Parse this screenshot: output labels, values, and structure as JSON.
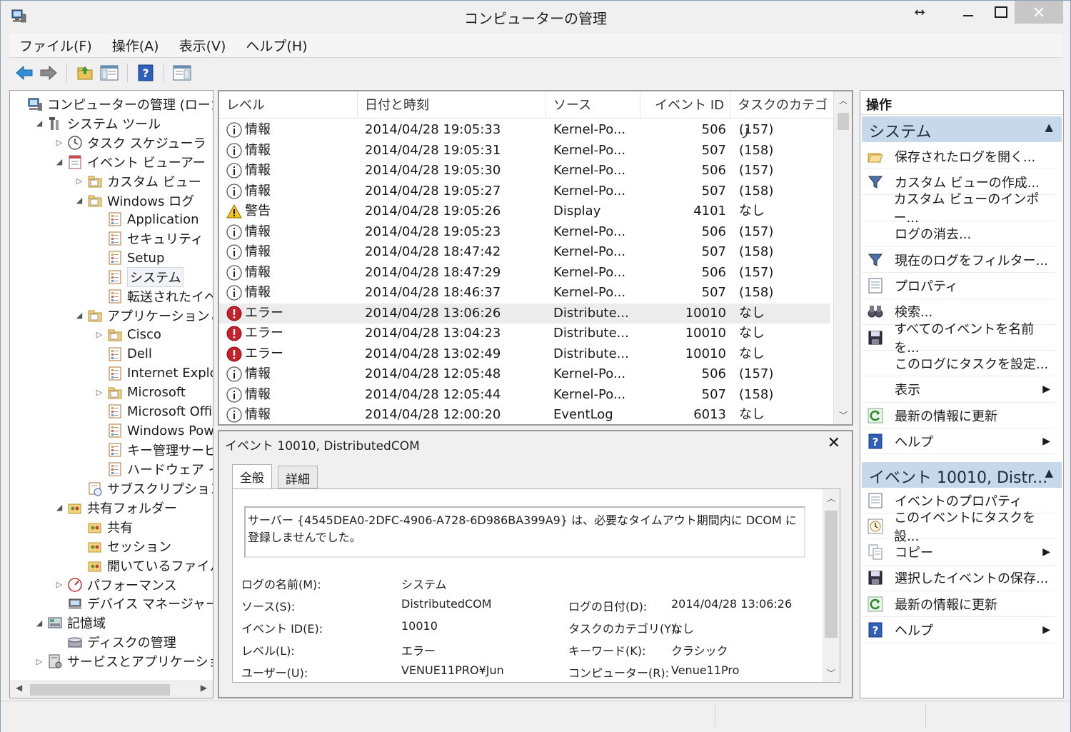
{
  "window": {
    "title": "コンピューターの管理"
  },
  "menu": [
    "ファイル(F)",
    "操作(A)",
    "表示(V)",
    "ヘルプ(H)"
  ],
  "tree": [
    {
      "label": "コンピューターの管理 (ローカル)",
      "depth": 0,
      "exp": "",
      "icon": "computer-mgmt-icon"
    },
    {
      "label": "システム ツール",
      "depth": 1,
      "exp": "◢",
      "icon": "system-tools-icon"
    },
    {
      "label": "タスク スケジューラ",
      "depth": 2,
      "exp": "▷",
      "icon": "clock-icon"
    },
    {
      "label": "イベント ビューアー",
      "depth": 2,
      "exp": "◢",
      "icon": "event-viewer-icon"
    },
    {
      "label": "カスタム ビュー",
      "depth": 3,
      "exp": "▷",
      "icon": "folder-icon"
    },
    {
      "label": "Windows ログ",
      "depth": 3,
      "exp": "◢",
      "icon": "folder-icon"
    },
    {
      "label": "Application",
      "depth": 4,
      "exp": "",
      "icon": "log-icon"
    },
    {
      "label": "セキュリティ",
      "depth": 4,
      "exp": "",
      "icon": "log-icon"
    },
    {
      "label": "Setup",
      "depth": 4,
      "exp": "",
      "icon": "log-icon"
    },
    {
      "label": "システム",
      "depth": 4,
      "exp": "",
      "icon": "log-icon",
      "selected": true
    },
    {
      "label": "転送されたイベント",
      "depth": 4,
      "exp": "",
      "icon": "log-icon"
    },
    {
      "label": "アプリケーションとサービ",
      "depth": 3,
      "exp": "◢",
      "icon": "folder-icon"
    },
    {
      "label": "Cisco",
      "depth": 4,
      "exp": "▷",
      "icon": "folder-icon"
    },
    {
      "label": "Dell",
      "depth": 4,
      "exp": "",
      "icon": "log-icon"
    },
    {
      "label": "Internet Explor",
      "depth": 4,
      "exp": "",
      "icon": "log-icon"
    },
    {
      "label": "Microsoft",
      "depth": 4,
      "exp": "▷",
      "icon": "folder-icon"
    },
    {
      "label": "Microsoft Office",
      "depth": 4,
      "exp": "",
      "icon": "log-icon"
    },
    {
      "label": "Windows Powe",
      "depth": 4,
      "exp": "",
      "icon": "log-icon"
    },
    {
      "label": "キー管理サービス",
      "depth": 4,
      "exp": "",
      "icon": "log-icon"
    },
    {
      "label": "ハードウェア イベン",
      "depth": 4,
      "exp": "",
      "icon": "log-icon"
    },
    {
      "label": "サブスクリプション",
      "depth": 3,
      "exp": "",
      "icon": "subscription-icon"
    },
    {
      "label": "共有フォルダー",
      "depth": 2,
      "exp": "◢",
      "icon": "shared-folder-icon"
    },
    {
      "label": "共有",
      "depth": 3,
      "exp": "",
      "icon": "shared-folder-icon"
    },
    {
      "label": "セッション",
      "depth": 3,
      "exp": "",
      "icon": "shared-folder-icon"
    },
    {
      "label": "開いているファイル",
      "depth": 3,
      "exp": "",
      "icon": "shared-folder-icon"
    },
    {
      "label": "パフォーマンス",
      "depth": 2,
      "exp": "▷",
      "icon": "performance-icon"
    },
    {
      "label": "デバイス マネージャー",
      "depth": 2,
      "exp": "",
      "icon": "device-manager-icon"
    },
    {
      "label": "記憶域",
      "depth": 1,
      "exp": "◢",
      "icon": "storage-icon"
    },
    {
      "label": "ディスクの管理",
      "depth": 2,
      "exp": "",
      "icon": "disk-icon"
    },
    {
      "label": "サービスとアプリケーション",
      "depth": 1,
      "exp": "▷",
      "icon": "services-icon"
    }
  ],
  "list": {
    "headers": [
      "レベル",
      "日付と時刻",
      "ソース",
      "イベント ID",
      "タスクのカテゴリ"
    ],
    "rows": [
      {
        "level": "情報",
        "type": "info",
        "datetime": "2014/04/28 19:05:33",
        "source": "Kernel-Po...",
        "id": "506",
        "category": "(157)"
      },
      {
        "level": "情報",
        "type": "info",
        "datetime": "2014/04/28 19:05:31",
        "source": "Kernel-Po...",
        "id": "507",
        "category": "(158)"
      },
      {
        "level": "情報",
        "type": "info",
        "datetime": "2014/04/28 19:05:30",
        "source": "Kernel-Po...",
        "id": "506",
        "category": "(157)"
      },
      {
        "level": "情報",
        "type": "info",
        "datetime": "2014/04/28 19:05:27",
        "source": "Kernel-Po...",
        "id": "507",
        "category": "(158)"
      },
      {
        "level": "警告",
        "type": "warn",
        "datetime": "2014/04/28 19:05:26",
        "source": "Display",
        "id": "4101",
        "category": "なし"
      },
      {
        "level": "情報",
        "type": "info",
        "datetime": "2014/04/28 19:05:23",
        "source": "Kernel-Po...",
        "id": "506",
        "category": "(157)"
      },
      {
        "level": "情報",
        "type": "info",
        "datetime": "2014/04/28 18:47:42",
        "source": "Kernel-Po...",
        "id": "507",
        "category": "(158)"
      },
      {
        "level": "情報",
        "type": "info",
        "datetime": "2014/04/28 18:47:29",
        "source": "Kernel-Po...",
        "id": "506",
        "category": "(157)"
      },
      {
        "level": "情報",
        "type": "info",
        "datetime": "2014/04/28 18:46:37",
        "source": "Kernel-Po...",
        "id": "507",
        "category": "(158)"
      },
      {
        "level": "エラー",
        "type": "error",
        "datetime": "2014/04/28 13:06:26",
        "source": "Distribute...",
        "id": "10010",
        "category": "なし",
        "selected": true
      },
      {
        "level": "エラー",
        "type": "error",
        "datetime": "2014/04/28 13:04:23",
        "source": "Distribute...",
        "id": "10010",
        "category": "なし"
      },
      {
        "level": "エラー",
        "type": "error",
        "datetime": "2014/04/28 13:02:49",
        "source": "Distribute...",
        "id": "10010",
        "category": "なし"
      },
      {
        "level": "情報",
        "type": "info",
        "datetime": "2014/04/28 12:05:48",
        "source": "Kernel-Po...",
        "id": "506",
        "category": "(157)"
      },
      {
        "level": "情報",
        "type": "info",
        "datetime": "2014/04/28 12:05:44",
        "source": "Kernel-Po...",
        "id": "507",
        "category": "(158)"
      },
      {
        "level": "情報",
        "type": "info",
        "datetime": "2014/04/28 12:00:20",
        "source": "EventLog",
        "id": "6013",
        "category": "なし"
      }
    ]
  },
  "details": {
    "title": "イベント 10010, DistributedCOM",
    "tabs": [
      "全般",
      "詳細"
    ],
    "message": "サーバー {4545DEA0-2DFC-4906-A728-6D986BA399A9} は、必要なタイムアウト期間内に DCOM に登録しませんでした。",
    "fields": {
      "log_name_label": "ログの名前(M):",
      "log_name": "システム",
      "source_label": "ソース(S):",
      "source": "DistributedCOM",
      "logged_label": "ログの日付(D):",
      "logged": "2014/04/28 13:06:26",
      "event_id_label": "イベント ID(E):",
      "event_id": "10010",
      "task_label": "タスクのカテゴリ(Y):",
      "task": "なし",
      "level_label": "レベル(L):",
      "level": "エラー",
      "keywords_label": "キーワード(K):",
      "keywords": "クラシック",
      "user_label": "ユーザー(U):",
      "user": "VENUE11PRO¥Jun",
      "computer_label": "コンピューター(R):",
      "computer": "Venue11Pro"
    }
  },
  "actions": {
    "header": "操作",
    "section1": "システム",
    "items1": [
      {
        "label": "保存されたログを開く...",
        "icon": "open-folder-icon",
        "arrow": false
      },
      {
        "label": "カスタム ビューの作成...",
        "icon": "filter-icon",
        "arrow": false
      },
      {
        "label": "カスタム ビューのインポー...",
        "icon": "",
        "arrow": false
      },
      {
        "label": "ログの消去...",
        "icon": "",
        "arrow": false
      },
      {
        "label": "現在のログをフィルター...",
        "icon": "filter-icon",
        "arrow": false
      },
      {
        "label": "プロパティ",
        "icon": "properties-icon",
        "arrow": false
      },
      {
        "label": "検索...",
        "icon": "binoculars-icon",
        "arrow": false
      },
      {
        "label": "すべてのイベントを名前を...",
        "icon": "save-icon",
        "arrow": false
      },
      {
        "label": "このログにタスクを設定...",
        "icon": "",
        "arrow": false
      },
      {
        "label": "表示",
        "icon": "",
        "arrow": true
      },
      {
        "label": "最新の情報に更新",
        "icon": "refresh-icon",
        "arrow": false
      },
      {
        "label": "ヘルプ",
        "icon": "help-icon",
        "arrow": true
      }
    ],
    "section2": "イベント 10010, Distr...",
    "items2": [
      {
        "label": "イベントのプロパティ",
        "icon": "properties-icon",
        "arrow": false
      },
      {
        "label": "このイベントにタスクを設...",
        "icon": "task-clock-icon",
        "arrow": false
      },
      {
        "label": "コピー",
        "icon": "copy-icon",
        "arrow": true
      },
      {
        "label": "選択したイベントの保存...",
        "icon": "save-icon",
        "arrow": false
      },
      {
        "label": "最新の情報に更新",
        "icon": "refresh-icon",
        "arrow": false
      },
      {
        "label": "ヘルプ",
        "icon": "help-icon",
        "arrow": true
      }
    ]
  }
}
